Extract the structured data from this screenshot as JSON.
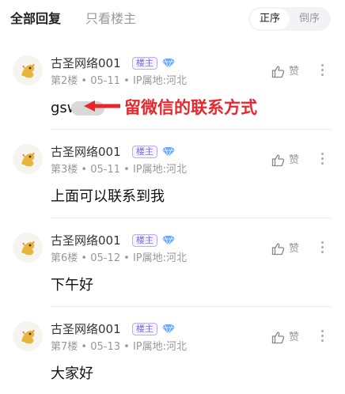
{
  "tabs": {
    "all_replies": "全部回复",
    "only_op": "只看楼主"
  },
  "sort": {
    "asc": "正序",
    "desc": "倒序"
  },
  "colors": {
    "accent_red": "#e8262b",
    "badge_purple": "#7b6bd6",
    "gem_blue": "#6aa8ff"
  },
  "replies": [
    {
      "username": "古圣网络001",
      "badge": "楼主",
      "floor": "第2楼",
      "date": "05-11",
      "location": "IP属地:河北",
      "like_label": "赞",
      "content": "gsw"
    },
    {
      "username": "古圣网络001",
      "badge": "楼主",
      "floor": "第3楼",
      "date": "05-11",
      "location": "IP属地:河北",
      "like_label": "赞",
      "content": "上面可以联系到我"
    },
    {
      "username": "古圣网络001",
      "badge": "楼主",
      "floor": "第6楼",
      "date": "05-12",
      "location": "IP属地:河北",
      "like_label": "赞",
      "content": "下午好"
    },
    {
      "username": "古圣网络001",
      "badge": "楼主",
      "floor": "第7楼",
      "date": "05-13",
      "location": "IP属地:河北",
      "like_label": "赞",
      "content": "大家好"
    }
  ],
  "annotation": {
    "text": "留微信的联系方式"
  },
  "separator": " • "
}
